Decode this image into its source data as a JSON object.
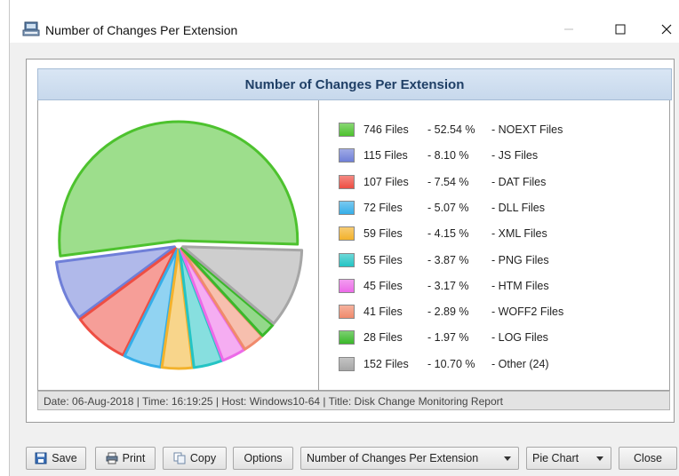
{
  "window": {
    "title": "Number of Changes Per Extension"
  },
  "chart": {
    "header": "Number of Changes Per Extension",
    "footer": "Date: 06-Aug-2018 | Time: 16:19:25 | Host: Windows10-64 | Title: Disk Change Monitoring Report"
  },
  "chart_data": {
    "type": "pie",
    "title": "Number of Changes Per Extension",
    "slices": [
      {
        "files": "746 Files",
        "pct": "- 52.54 %",
        "label": "- NOEXT Files",
        "value": 746,
        "color": "#4dc22e"
      },
      {
        "files": "115 Files",
        "pct": "- 8.10 %",
        "label": "- JS Files",
        "value": 115,
        "color": "#6f7fd8"
      },
      {
        "files": "107 Files",
        "pct": "- 7.54 %",
        "label": "- DAT Files",
        "value": 107,
        "color": "#ee4e43"
      },
      {
        "files": "72 Files",
        "pct": "- 5.07 %",
        "label": "- DLL Files",
        "value": 72,
        "color": "#36aee8"
      },
      {
        "files": "59 Files",
        "pct": "- 4.15 %",
        "label": "- XML Files",
        "value": 59,
        "color": "#f3b22c"
      },
      {
        "files": "55 Files",
        "pct": "- 3.87 %",
        "label": "- PNG Files",
        "value": 55,
        "color": "#24c4c4"
      },
      {
        "files": "45 Files",
        "pct": "- 3.17 %",
        "label": "- HTM Files",
        "value": 45,
        "color": "#ec6ae8"
      },
      {
        "files": "41 Files",
        "pct": "- 2.89 %",
        "label": "- WOFF2 Files",
        "value": 41,
        "color": "#f08a6c"
      },
      {
        "files": "28 Files",
        "pct": "- 1.97 %",
        "label": "- LOG Files",
        "value": 28,
        "color": "#3ab82a"
      },
      {
        "files": "152 Files",
        "pct": "- 10.70 %",
        "label": "- Other (24)",
        "value": 152,
        "color": "#a6a6a6"
      }
    ]
  },
  "toolbar": {
    "save": "Save",
    "print": "Print",
    "copy": "Copy",
    "options": "Options",
    "report_select": "Number of Changes Per Extension",
    "chart_type_select": "Pie Chart",
    "close": "Close"
  }
}
